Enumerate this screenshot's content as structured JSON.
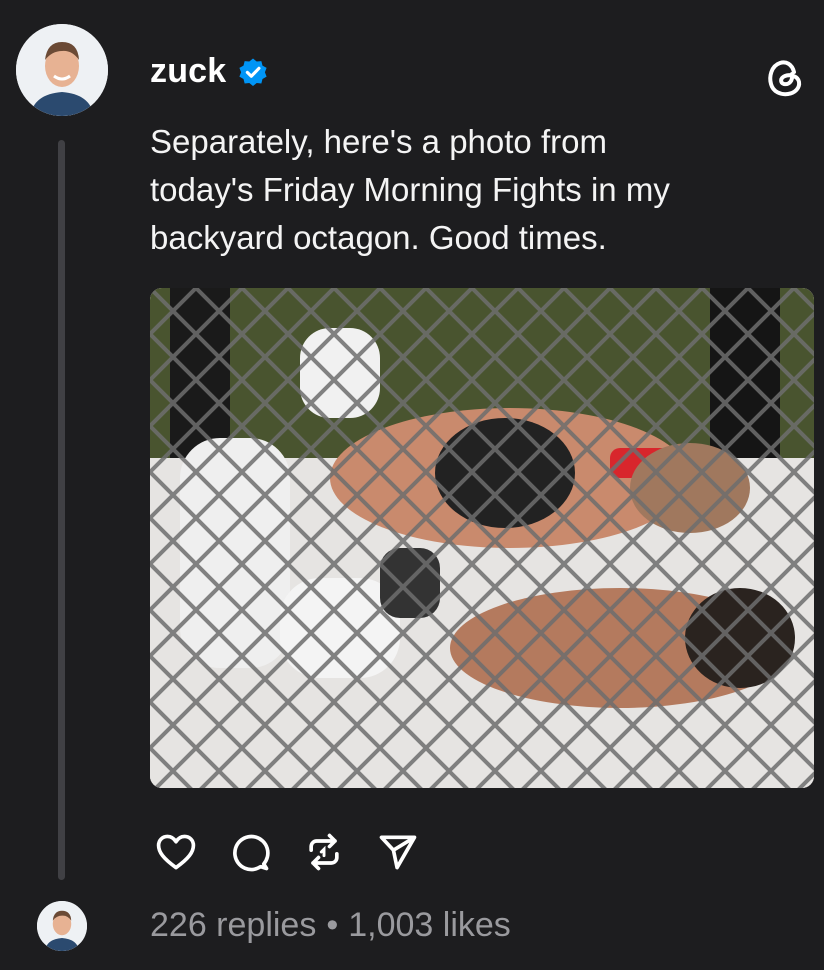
{
  "post": {
    "username": "zuck",
    "verified": true,
    "caption": "Separately, here's a photo from\ntoday's Friday Morning Fights in my\nbackyard octagon. Good times.",
    "image_alt": "Two fighters grappling on a mat behind a chain-link cage fence"
  },
  "app": {
    "logo_icon": "threads-logo-icon"
  },
  "actions": [
    {
      "name": "like-button",
      "icon": "heart-icon"
    },
    {
      "name": "reply-button",
      "icon": "comment-icon"
    },
    {
      "name": "repost-button",
      "icon": "repost-icon"
    },
    {
      "name": "share-button",
      "icon": "send-icon"
    }
  ],
  "stats": {
    "replies": "226 replies",
    "separator": "•",
    "likes": "1,003 likes"
  },
  "colors": {
    "background": "#1d1d1f",
    "verified_blue": "#0095f6",
    "muted_text": "#9a9a9e"
  }
}
